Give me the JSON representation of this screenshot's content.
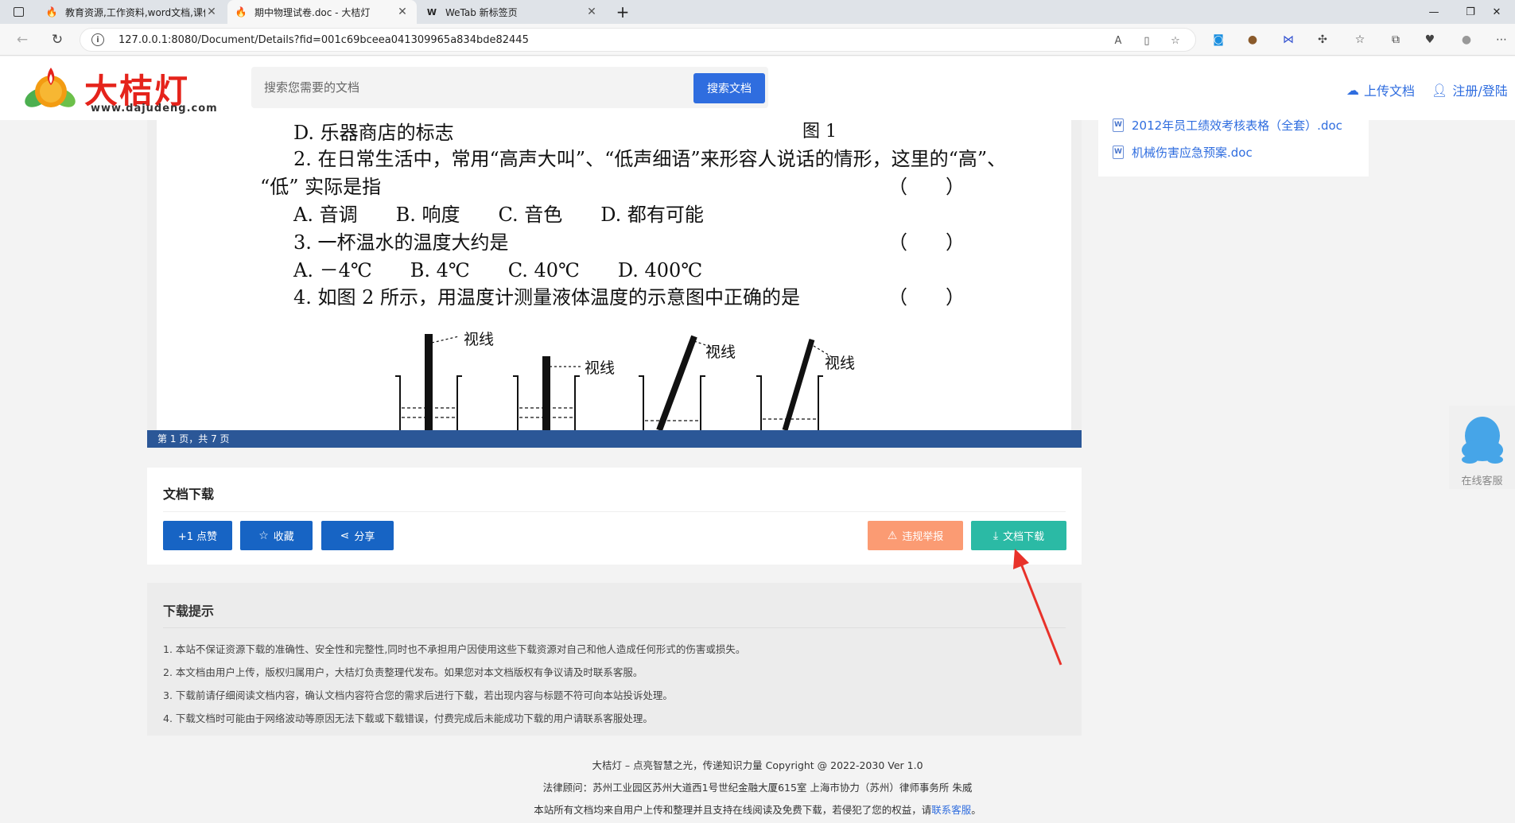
{
  "browser": {
    "tabs": [
      {
        "title": "教育资源,工作资料,word文档,课件",
        "active": false
      },
      {
        "title": "期中物理试卷.doc - 大桔灯",
        "active": true
      },
      {
        "title": "WeTab 新标签页",
        "active": false
      }
    ],
    "url": "127.0.0.1:8080/Document/Details?fid=001c69bceea041309965a834bde82445"
  },
  "header": {
    "logo_text": "大桔灯",
    "logo_url": "www.dajudeng.com",
    "search_placeholder": "搜索您需要的文档",
    "search_button": "搜索文档",
    "upload_link": "上传文档",
    "login_link": "注册/登陆"
  },
  "document": {
    "lines": [
      "D. 乐器商店的标志",
      "图 1",
      "2. 在日常生活中，常用“高声大叫”、“低声细语”来形容人说话的情形，这里的“高”、",
      "“低” 实际是指",
      "（　　）",
      "A. 音调　　B. 响度　　C. 音色　　D. 都有可能",
      "3. 一杯温水的温度大约是",
      "（　　）",
      "A. －4℃　　B. 4℃　　C. 40℃　　D. 400℃",
      "4. 如图 2 所示，用温度计测量液体温度的示意图中正确的是",
      "（　　）"
    ],
    "diagram_labels": [
      "视线",
      "视线",
      "视线",
      "视线"
    ],
    "page_indicator": "第 1 页，共 7 页"
  },
  "sidebar": {
    "items": [
      {
        "label": "2012年员工绩效考核表格（全套）.doc"
      },
      {
        "label": "机械伤害应急预案.doc"
      }
    ]
  },
  "download_panel": {
    "title": "文档下载",
    "like_button": "+1 点赞",
    "favorite_button": "收藏",
    "share_button": "分享",
    "report_button": "违规举报",
    "download_button": "文档下载"
  },
  "tips": {
    "title": "下载提示",
    "items": [
      "1. 本站不保证资源下载的准确性、安全性和完整性,同时也不承担用户因使用这些下载资源对自己和他人造成任何形式的伤害或损失。",
      "2. 本文档由用户上传，版权归属用户，大桔灯负责整理代发布。如果您对本文档版权有争议请及时联系客服。",
      "3. 下载前请仔细阅读文档内容，确认文档内容符合您的需求后进行下载，若出现内容与标题不符可向本站投诉处理。",
      "4. 下载文档时可能由于网络波动等原因无法下载或下载错误，付费完成后未能成功下载的用户请联系客服处理。"
    ]
  },
  "footer": {
    "line1": "大桔灯 – 点亮智慧之光，传递知识力量 Copyright @ 2022-2030 Ver 1.0",
    "line2": "法律顾问：苏州工业园区苏州大道西1号世纪金融大厦615室 上海市协力（苏州）律师事务所 朱威",
    "line3_prefix": "本站所有文档均来自用户上传和整理并且支持在线阅读及免费下载，若侵犯了您的权益，请",
    "line3_link": "联系客服",
    "line3_suffix": "。"
  },
  "service": {
    "label": "在线客服"
  },
  "colors": {
    "brand_blue": "#2f6ddf",
    "logo_red": "#e5231b",
    "download_teal": "#2bbaa5",
    "report_orange": "#fb9b73",
    "page_bar": "#2b5797",
    "annotation_red": "#e8322a"
  }
}
